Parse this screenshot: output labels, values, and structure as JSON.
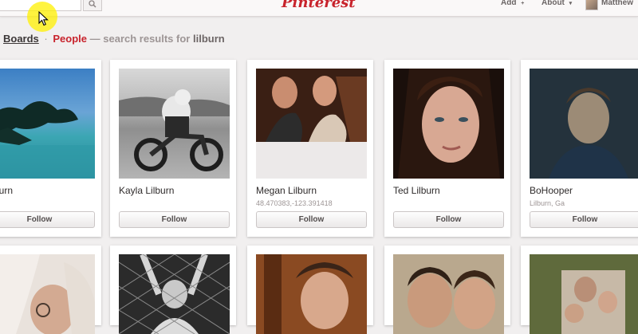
{
  "header": {
    "logo": "Pinterest",
    "nav_add": "Add",
    "nav_add_suffix": "+",
    "nav_about": "About",
    "nav_about_caret": "▾",
    "user_name": "Matthew"
  },
  "breadcrumb": {
    "boards": "Boards",
    "separator": "·",
    "people": "People",
    "text": "— search results for",
    "query": "lilburn"
  },
  "colors": {
    "brand_red": "#c8232c",
    "background": "#f1efef"
  },
  "people": [
    {
      "name": "Lilburn",
      "subtitle": "",
      "follow_label": "Follow"
    },
    {
      "name": "Kayla Lilburn",
      "subtitle": "",
      "follow_label": "Follow"
    },
    {
      "name": "Megan Lilburn",
      "subtitle": "48.470383,-123.391418",
      "follow_label": "Follow"
    },
    {
      "name": "Ted Lilburn",
      "subtitle": "",
      "follow_label": "Follow"
    },
    {
      "name": "BoHooper",
      "subtitle": "Lilburn, Ga",
      "follow_label": "Follow"
    }
  ],
  "icons": {
    "search": "search-icon",
    "cursor": "cursor-icon"
  }
}
